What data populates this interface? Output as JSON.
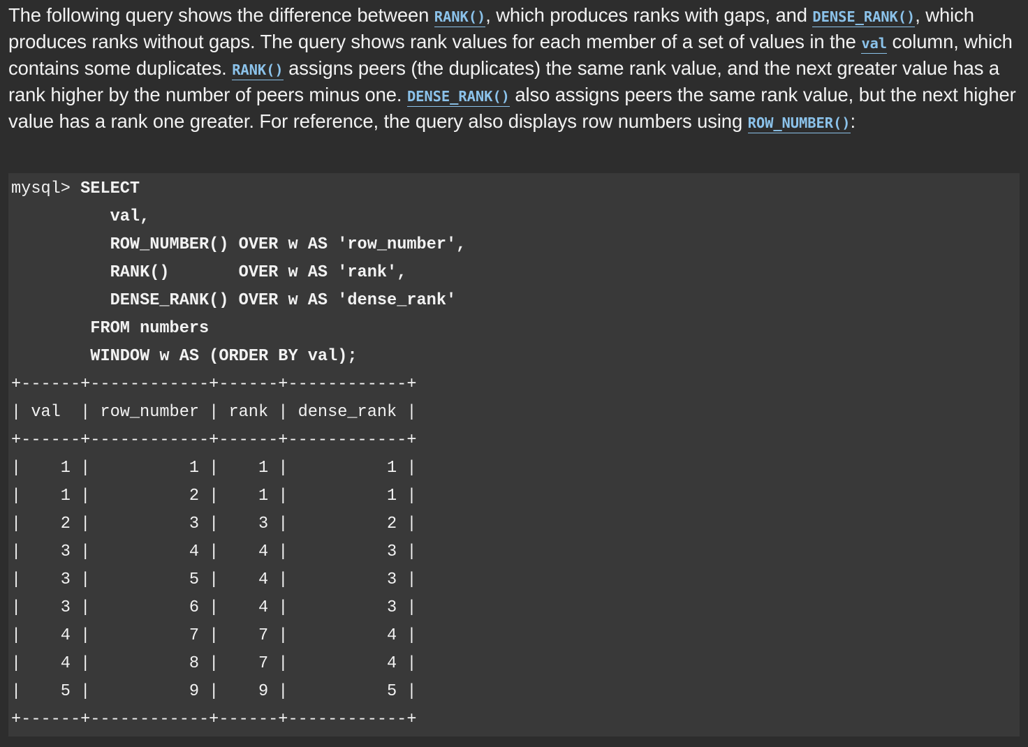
{
  "paragraph": {
    "t1": "The following query shows the difference between ",
    "c1": "RANK()",
    "t2": ", which produces ranks with gaps, and ",
    "c2": "DENSE_RANK()",
    "t3": ", which produces ranks without gaps. The query shows rank values for each member of a set of values in the ",
    "c3": "val",
    "t4": " column, which contains some duplicates. ",
    "c4": "RANK()",
    "t5": " assigns peers (the duplicates) the same rank value, and the next greater value has a rank higher by the number of peers minus one. ",
    "c5": "DENSE_RANK()",
    "t6": " also assigns peers the same rank value, but the next higher value has a rank one greater. For reference, the query also displays row numbers using ",
    "c6": "ROW_NUMBER()",
    "t7": ":"
  },
  "code": {
    "prompt": "mysql> ",
    "q1": "SELECT",
    "q2": "val,",
    "q3": "ROW_NUMBER() OVER w AS 'row_number',",
    "q4": "RANK()       OVER w AS 'rank',",
    "q5": "DENSE_RANK() OVER w AS 'dense_rank'",
    "q6": "FROM numbers",
    "q7": "WINDOW w AS (ORDER BY val);",
    "table": [
      "+------+------------+------+------------+",
      "| val  | row_number | rank | dense_rank |",
      "+------+------------+------+------------+",
      "|    1 |          1 |    1 |          1 |",
      "|    1 |          2 |    1 |          1 |",
      "|    2 |          3 |    3 |          2 |",
      "|    3 |          4 |    4 |          3 |",
      "|    3 |          5 |    4 |          3 |",
      "|    3 |          6 |    4 |          3 |",
      "|    4 |          7 |    7 |          4 |",
      "|    4 |          8 |    7 |          4 |",
      "|    5 |          9 |    9 |          5 |",
      "+------+------------+------+------------+"
    ]
  }
}
